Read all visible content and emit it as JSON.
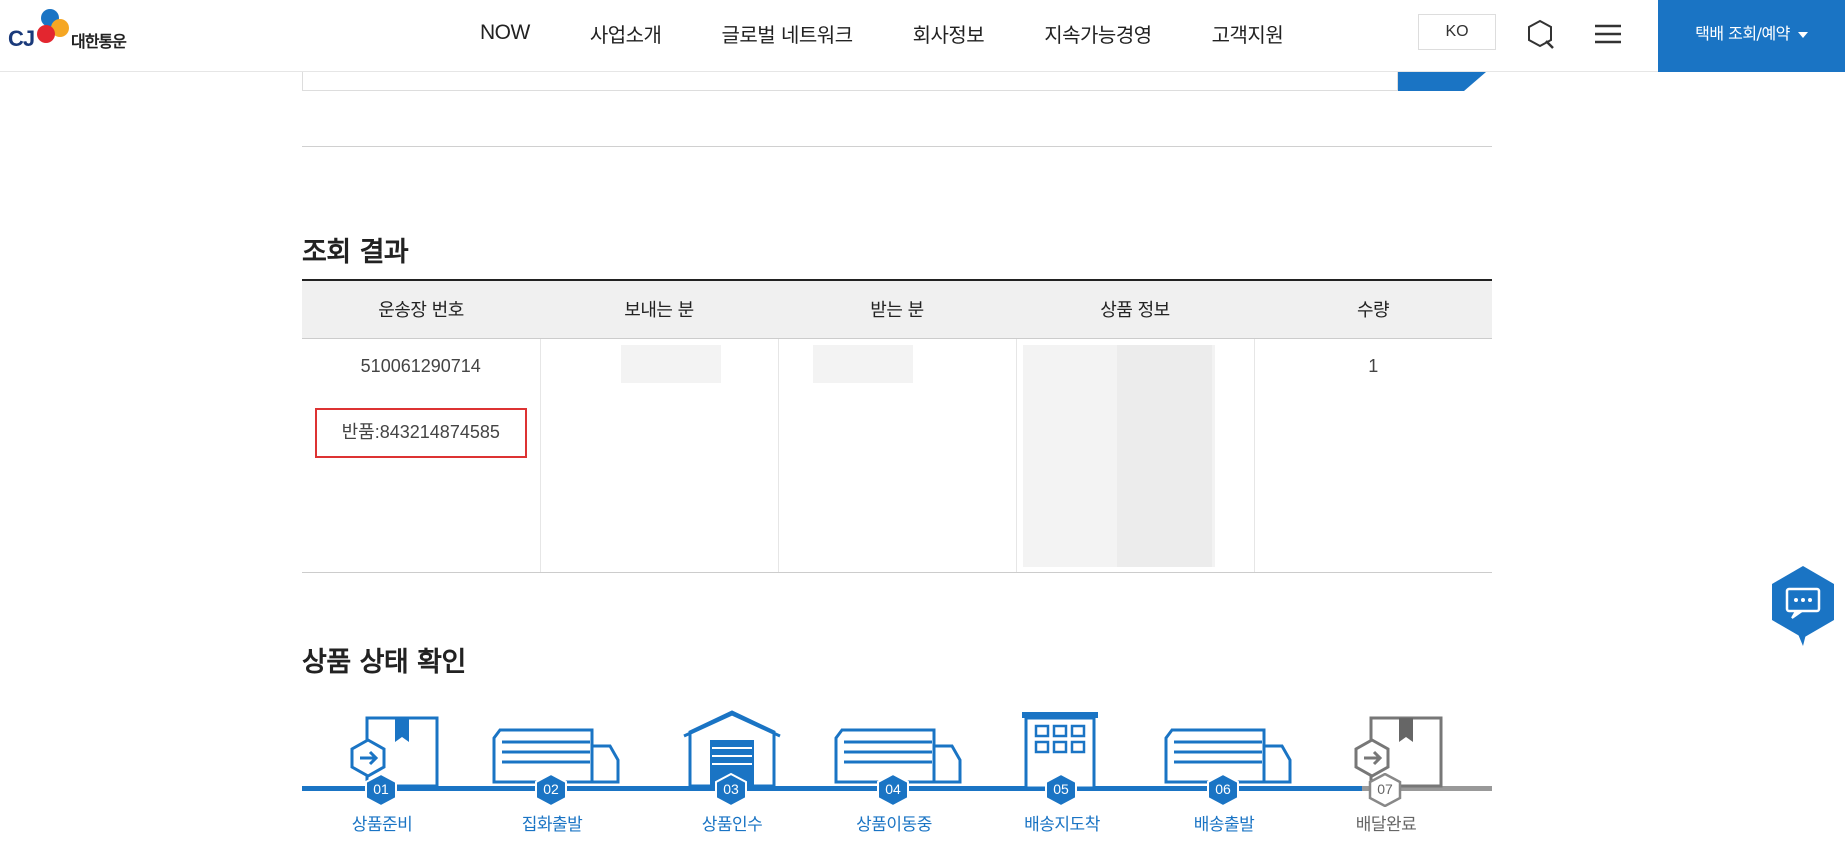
{
  "header": {
    "logo_cj": "CJ",
    "logo_text": "대한통운",
    "nav": [
      "NOW",
      "사업소개",
      "글로벌 네트워크",
      "회사정보",
      "지속가능경영",
      "고객지원"
    ],
    "lang": "KO",
    "track_button": "택배 조회/예약"
  },
  "results": {
    "title": "조회 결과",
    "columns": [
      "운송장 번호",
      "보내는 분",
      "받는 분",
      "상품 정보",
      "수량"
    ],
    "row": {
      "tracking_number": "510061290714",
      "return_label": "반품:843214874585",
      "quantity": "1"
    }
  },
  "status": {
    "title": "상품 상태 확인",
    "steps": [
      {
        "num": "01",
        "label": "상품준비",
        "icon": "package-icon",
        "state": "done"
      },
      {
        "num": "02",
        "label": "집화출발",
        "icon": "truck-icon",
        "state": "done"
      },
      {
        "num": "03",
        "label": "상품인수",
        "icon": "warehouse-icon",
        "state": "done"
      },
      {
        "num": "04",
        "label": "상품이동중",
        "icon": "truck-icon",
        "state": "done"
      },
      {
        "num": "05",
        "label": "배송지도착",
        "icon": "building-icon",
        "state": "done"
      },
      {
        "num": "06",
        "label": "배송출발",
        "icon": "truck-icon",
        "state": "done"
      },
      {
        "num": "07",
        "label": "배달완료",
        "icon": "package-icon",
        "state": "pending"
      }
    ]
  },
  "colors": {
    "brand_blue": "#1a74c4",
    "highlight_red": "#dd3333",
    "pending_gray": "#999999"
  }
}
